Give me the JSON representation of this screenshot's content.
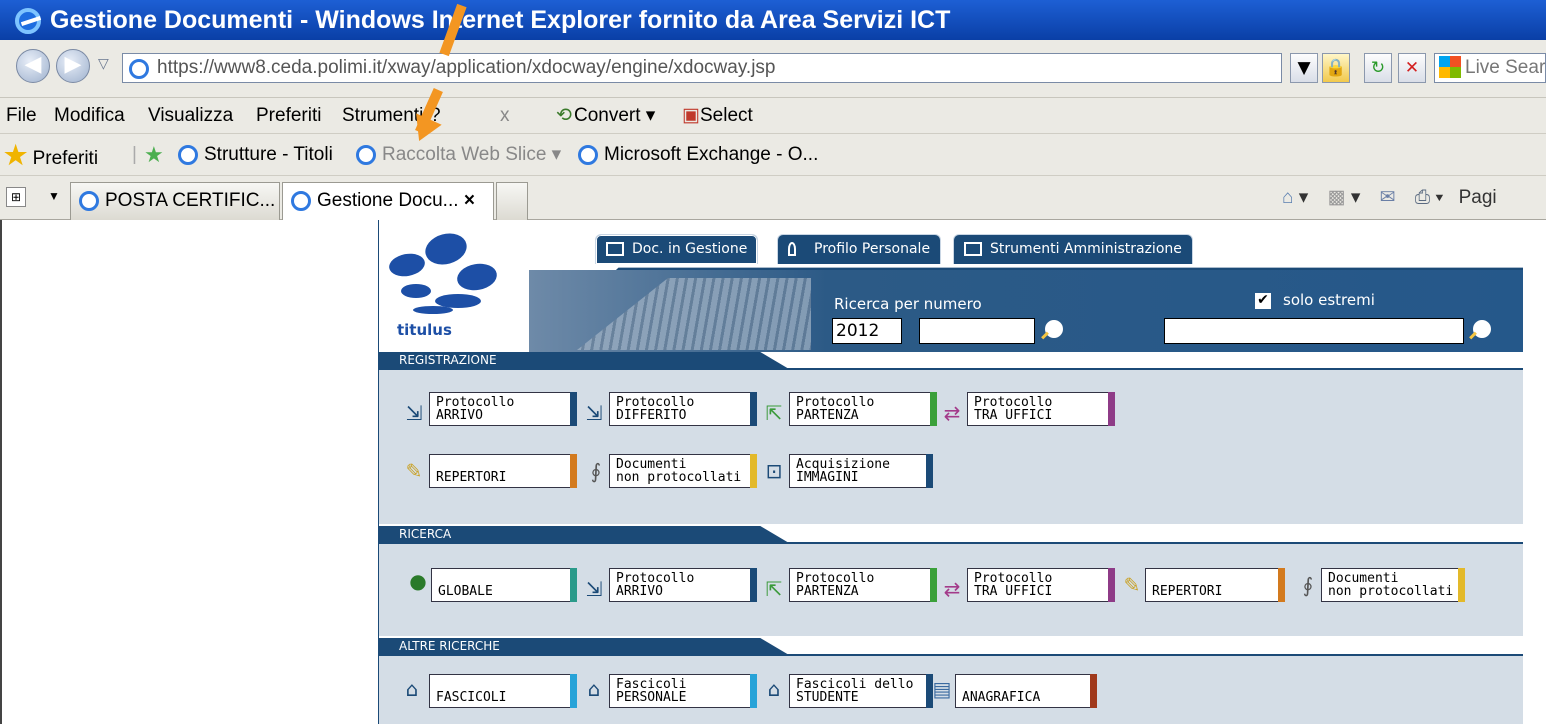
{
  "window": {
    "title": "Gestione Documenti - Windows Internet Explorer fornito da Area Servizi ICT"
  },
  "address": {
    "url": "https://www8.ceda.polimi.it/xway/application/xdocway/engine/xdocway.jsp",
    "search_placeholder": "Live Sear"
  },
  "menu": {
    "items": [
      "File",
      "Modifica",
      "Visualizza",
      "Preferiti",
      "Strumenti",
      "?",
      "x",
      "Convert ▾",
      "Select"
    ]
  },
  "favorites": {
    "items": [
      "Preferiti",
      "Strutture - Titoli",
      "Raccolta Web Slice ▾",
      "Microsoft Exchange - O..."
    ]
  },
  "tabs": {
    "items": [
      {
        "label": "POSTA CERTIFIC..."
      },
      {
        "label": "Gestione Docu...",
        "close": "×"
      }
    ],
    "page_label": "Pagi"
  },
  "app": {
    "logo_text": "titulus",
    "nav_tabs": [
      "Doc. in Gestione",
      "Profilo Personale",
      "Strumenti Amministrazione"
    ],
    "search": {
      "label": "Ricerca per numero",
      "year": "2012",
      "number": "",
      "solo_estremi_label": "solo estremi",
      "solo_estremi_checked": true,
      "fulltext": ""
    },
    "sections": [
      {
        "title": "REGISTRAZIONE"
      },
      {
        "title": "RICERCA"
      },
      {
        "title": "ALTRE RICERCHE"
      }
    ],
    "registrazione": {
      "row1": [
        "Protocollo\nARRIVO",
        "Protocollo\nDIFFERITO",
        "Protocollo\nPARTENZA",
        "Protocollo\nTRA UFFICI"
      ],
      "row2": [
        "REPERTORI",
        "Documenti\nnon protocollati",
        "Acquisizione\nIMMAGINI"
      ]
    },
    "ricerca": [
      "GLOBALE",
      "Protocollo\nARRIVO",
      "Protocollo\nPARTENZA",
      "Protocollo\nTRA UFFICI",
      "REPERTORI",
      "Documenti\nnon protocollati"
    ],
    "altre": [
      "FASCICOLI",
      "Fascicoli\nPERSONALE",
      "Fascicoli dello\nSTUDENTE",
      "ANAGRAFICA"
    ]
  },
  "colors": {
    "ie_blue": "#0a3fa6",
    "app_navy": "#1b4a77",
    "arrow": "#f39622"
  }
}
